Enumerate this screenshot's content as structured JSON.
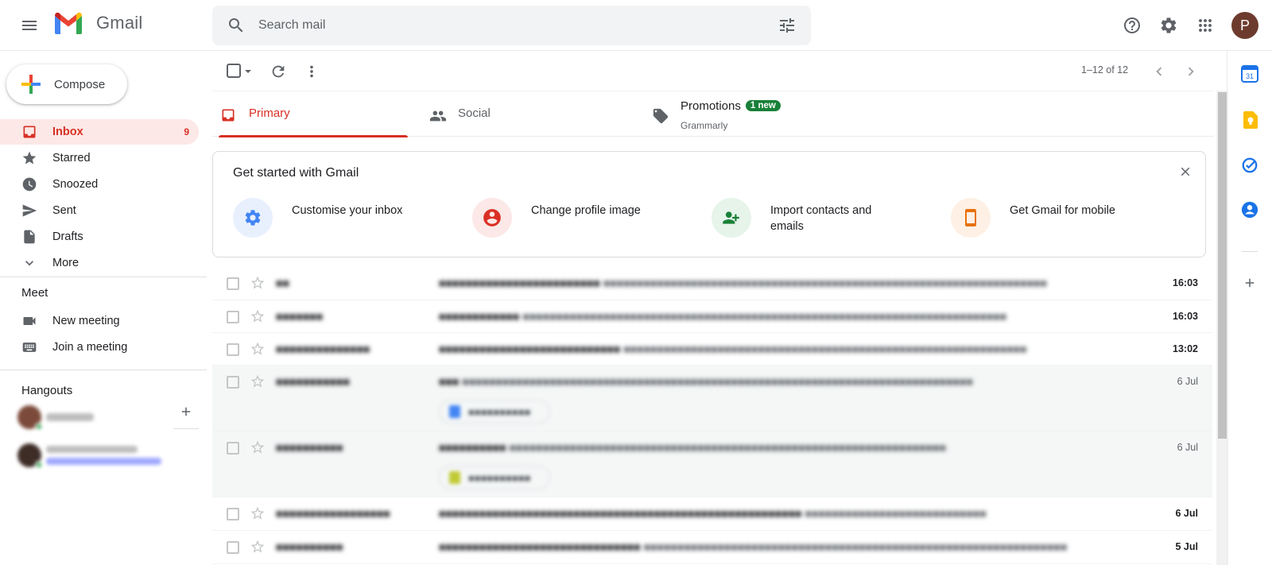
{
  "app": {
    "name": "Gmail"
  },
  "header": {
    "search_placeholder": "Search mail",
    "avatar_letter": "P"
  },
  "sidebar": {
    "compose_label": "Compose",
    "items": [
      {
        "label": "Inbox",
        "count": "9"
      },
      {
        "label": "Starred"
      },
      {
        "label": "Snoozed"
      },
      {
        "label": "Sent"
      },
      {
        "label": "Drafts"
      },
      {
        "label": "More"
      }
    ],
    "meet": {
      "title": "Meet",
      "items": [
        {
          "label": "New meeting"
        },
        {
          "label": "Join a meeting"
        }
      ]
    },
    "hangouts": {
      "title": "Hangouts"
    }
  },
  "toolbar": {
    "page_info": "1–12 of 12"
  },
  "tabs": [
    {
      "label": "Primary"
    },
    {
      "label": "Social"
    },
    {
      "label": "Promotions",
      "badge": "1 new",
      "sub": "Grammarly"
    }
  ],
  "get_started": {
    "title": "Get started with Gmail",
    "items": [
      {
        "label": "Customise your inbox"
      },
      {
        "label": "Change profile image"
      },
      {
        "label": "Import contacts and emails"
      },
      {
        "label": "Get Gmail for mobile"
      }
    ]
  },
  "emails": [
    {
      "date": "16:03",
      "unread": true
    },
    {
      "date": "16:03",
      "unread": true
    },
    {
      "date": "13:02",
      "unread": true
    },
    {
      "date": "6 Jul",
      "unread": false,
      "attachment": true
    },
    {
      "date": "6 Jul",
      "unread": false,
      "attachment": true
    },
    {
      "date": "6 Jul",
      "unread": true
    },
    {
      "date": "5 Jul",
      "unread": true
    }
  ],
  "colors": {
    "accent_red": "#d93025",
    "active_bg": "#fce8e6",
    "badge_green": "#188038"
  }
}
